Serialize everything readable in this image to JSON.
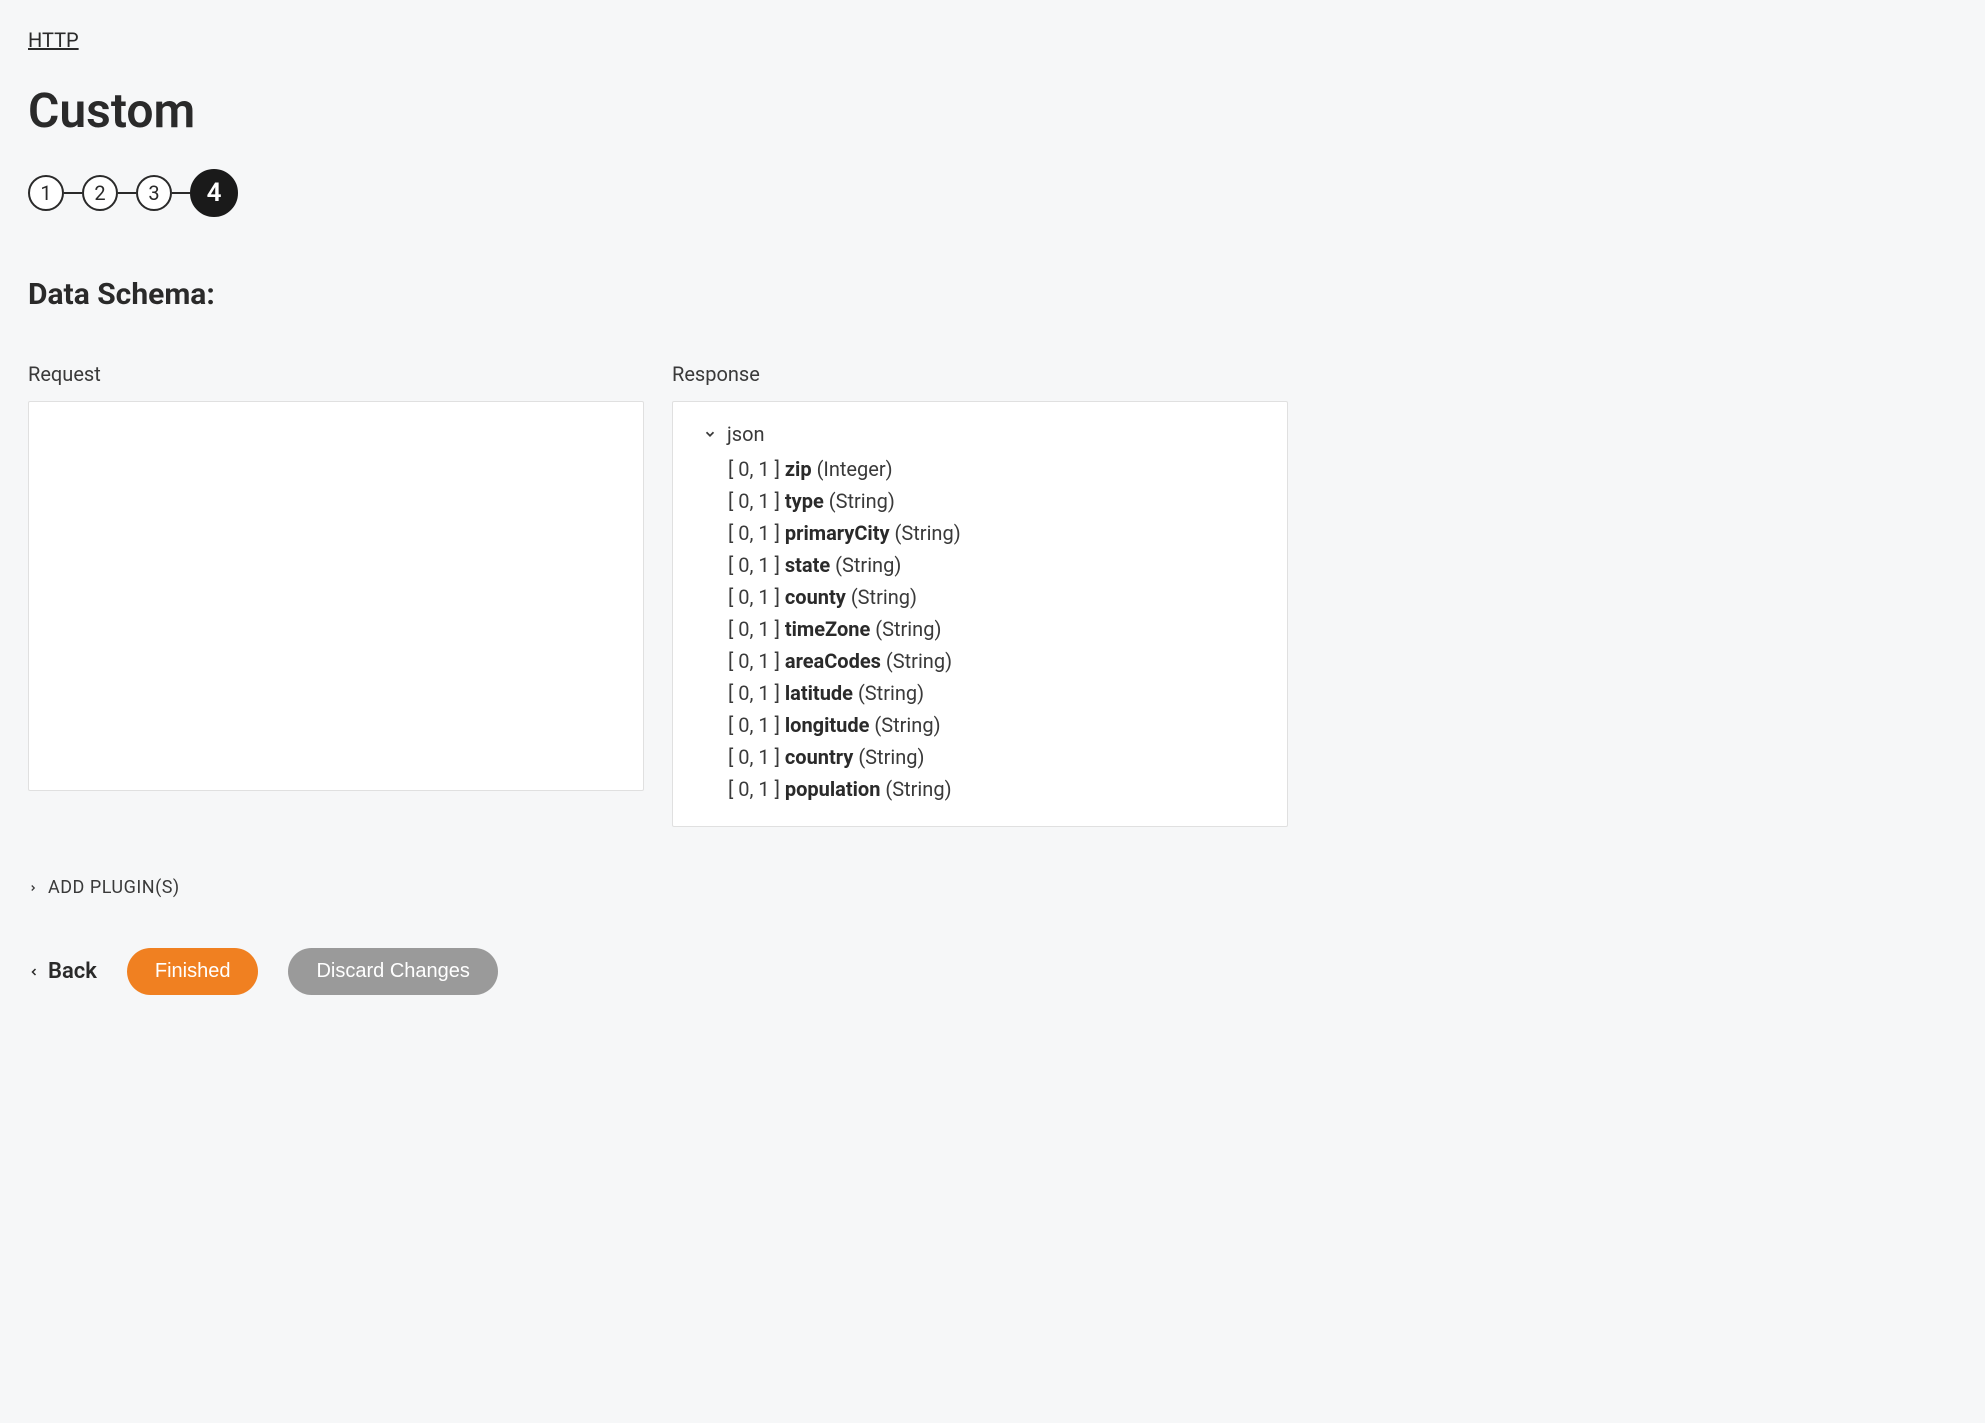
{
  "breadcrumb": "HTTP",
  "pageTitle": "Custom",
  "stepper": {
    "steps": [
      "1",
      "2",
      "3",
      "4"
    ],
    "activeIndex": 3
  },
  "sectionTitle": "Data Schema:",
  "request": {
    "label": "Request"
  },
  "response": {
    "label": "Response",
    "rootLabel": "json",
    "fields": [
      {
        "cardinality": "[ 0, 1 ]",
        "name": "zip",
        "type": "(Integer)"
      },
      {
        "cardinality": "[ 0, 1 ]",
        "name": "type",
        "type": "(String)"
      },
      {
        "cardinality": "[ 0, 1 ]",
        "name": "primaryCity",
        "type": "(String)"
      },
      {
        "cardinality": "[ 0, 1 ]",
        "name": "state",
        "type": "(String)"
      },
      {
        "cardinality": "[ 0, 1 ]",
        "name": "county",
        "type": "(String)"
      },
      {
        "cardinality": "[ 0, 1 ]",
        "name": "timeZone",
        "type": "(String)"
      },
      {
        "cardinality": "[ 0, 1 ]",
        "name": "areaCodes",
        "type": "(String)"
      },
      {
        "cardinality": "[ 0, 1 ]",
        "name": "latitude",
        "type": "(String)"
      },
      {
        "cardinality": "[ 0, 1 ]",
        "name": "longitude",
        "type": "(String)"
      },
      {
        "cardinality": "[ 0, 1 ]",
        "name": "country",
        "type": "(String)"
      },
      {
        "cardinality": "[ 0, 1 ]",
        "name": "population",
        "type": "(String)"
      }
    ]
  },
  "addPlugins": "ADD PLUGIN(S)",
  "buttons": {
    "back": "Back",
    "finished": "Finished",
    "discard": "Discard Changes"
  }
}
